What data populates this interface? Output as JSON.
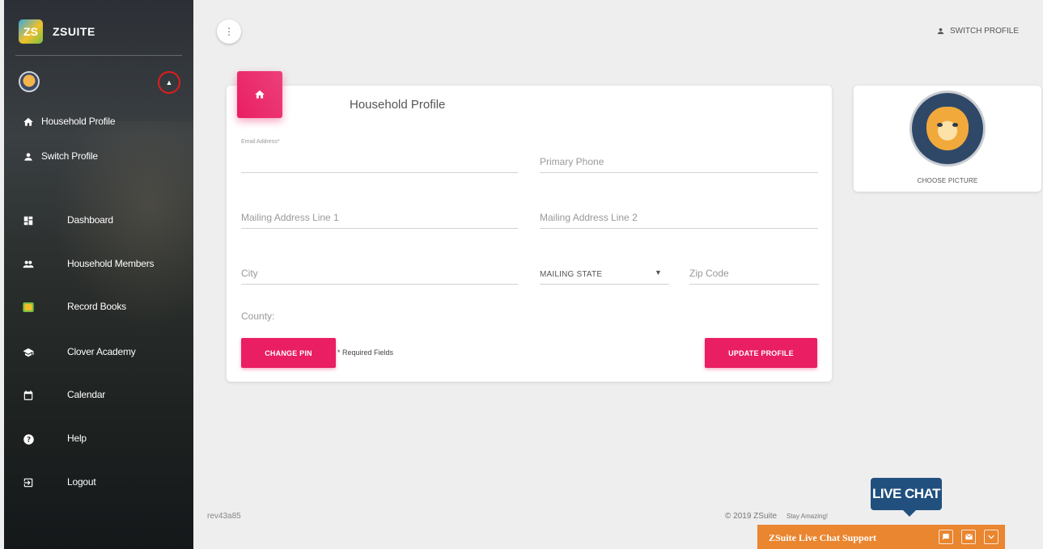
{
  "brand": {
    "name": "ZSUITE",
    "logo_text": "ZS"
  },
  "sidebar": {
    "items": [
      {
        "label": "Household Profile",
        "icon": "home-icon"
      },
      {
        "label": "Switch Profile",
        "icon": "person-icon"
      },
      {
        "label": "Dashboard",
        "icon": "dashboard-icon"
      },
      {
        "label": "Household Members",
        "icon": "people-icon"
      },
      {
        "label": "Record Books",
        "icon": "record-books-icon"
      },
      {
        "label": "Clover Academy",
        "icon": "school-icon"
      },
      {
        "label": "Calendar",
        "icon": "calendar-icon"
      },
      {
        "label": "Help",
        "icon": "help-icon"
      },
      {
        "label": "Logout",
        "icon": "logout-icon"
      }
    ]
  },
  "header": {
    "switch_profile": "SWITCH PROFILE"
  },
  "form": {
    "title": "Household Profile",
    "email_label": "Email Address*",
    "primary_phone_placeholder": "Primary Phone",
    "mailing_line1_placeholder": "Mailing Address Line 1",
    "mailing_line2_placeholder": "Mailing Address Line 2",
    "city_placeholder": "City",
    "mailing_state_value": "MAILING STATE",
    "zip_placeholder": "Zip Code",
    "county_label": "County:",
    "change_pin_label": "CHANGE PIN",
    "required_note": "* Required Fields",
    "update_profile_label": "UPDATE PROFILE"
  },
  "picture": {
    "choose_label": "CHOOSE PICTURE"
  },
  "footer": {
    "revision": "rev43a85",
    "copyright": "© 2019 ZSuite",
    "tagline": "Stay Amazing!"
  },
  "chat": {
    "bubble_label": "LIVE CHAT",
    "bar_label": "ZSuite Live Chat Support"
  },
  "colors": {
    "accent": "#e91e63",
    "chat_orange": "#ea8530",
    "chat_blue": "#21507f"
  }
}
